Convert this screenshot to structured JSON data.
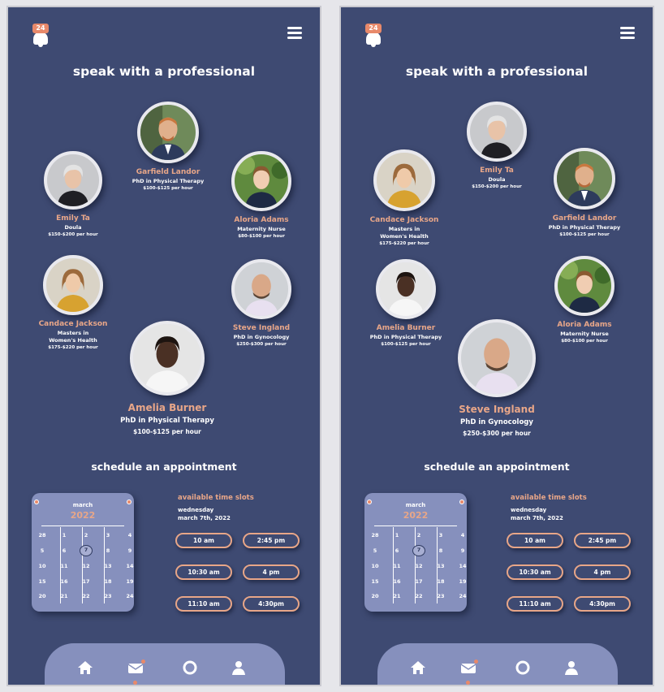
{
  "logo_badge": "24",
  "screens": [
    {
      "title": "speak with a professional",
      "professionals": [
        {
          "name": "Garfield Landor",
          "cred": "PhD in Physical Therapy",
          "price": "$100-$125 per hour"
        },
        {
          "name": "Emily Ta",
          "cred": "Doula",
          "price": "$150-$200 per hour"
        },
        {
          "name": "Aloria Adams",
          "cred": "Maternity Nurse",
          "price": "$80-$100 per hour"
        },
        {
          "name": "Candace Jackson",
          "cred": "Masters in\nWomen's Health",
          "price": "$175-$220 per hour"
        },
        {
          "name": "Steve Ingland",
          "cred": "PhD in Gynocology",
          "price": "$250-$300 per hour"
        },
        {
          "name": "Amelia Burner",
          "cred": "PhD in Physical Therapy",
          "price": "$100-$125 per hour"
        }
      ],
      "schedule_title": "schedule an appointment"
    },
    {
      "title": "speak with a professional",
      "professionals": [
        {
          "name": "Emily Ta",
          "cred": "Doula",
          "price": "$150-$200 per hour"
        },
        {
          "name": "Candace Jackson",
          "cred": "Masters in\nWomen's Health",
          "price": "$175-$220 per hour"
        },
        {
          "name": "Garfield Landor",
          "cred": "PhD in Physical Therapy",
          "price": "$100-$125 per hour"
        },
        {
          "name": "Amelia Burner",
          "cred": "PhD in Physical Therapy",
          "price": "$100-$125 per hour"
        },
        {
          "name": "Aloria Adams",
          "cred": "Maternity Nurse",
          "price": "$80-$100 per hour"
        },
        {
          "name": "Steve Ingland",
          "cred": "PhD in Gynocology",
          "price": "$250-$300 per hour"
        }
      ],
      "schedule_title": "schedule an appointment"
    }
  ],
  "calendar": {
    "month": "march",
    "year": "2022",
    "selected": "7",
    "days": [
      "28",
      "1",
      "2",
      "3",
      "4",
      "5",
      "6",
      "7",
      "8",
      "9",
      "10",
      "11",
      "12",
      "13",
      "14",
      "15",
      "16",
      "17",
      "18",
      "19",
      "20",
      "21",
      "22",
      "23",
      "24"
    ]
  },
  "slots": {
    "heading": "available time slots",
    "day": "wednesday",
    "date": "march 7th, 2022",
    "times": [
      "10 am",
      "2:45 pm",
      "10:30 am",
      "4 pm",
      "11:10 am",
      "4:30pm"
    ]
  },
  "nav": {
    "items": [
      "home-icon",
      "mail-icon",
      "support-icon",
      "profile-icon"
    ],
    "active": "mail-icon"
  },
  "colors": {
    "background": "#3e4a72",
    "accent": "#e8a688",
    "card": "#8690bd"
  }
}
